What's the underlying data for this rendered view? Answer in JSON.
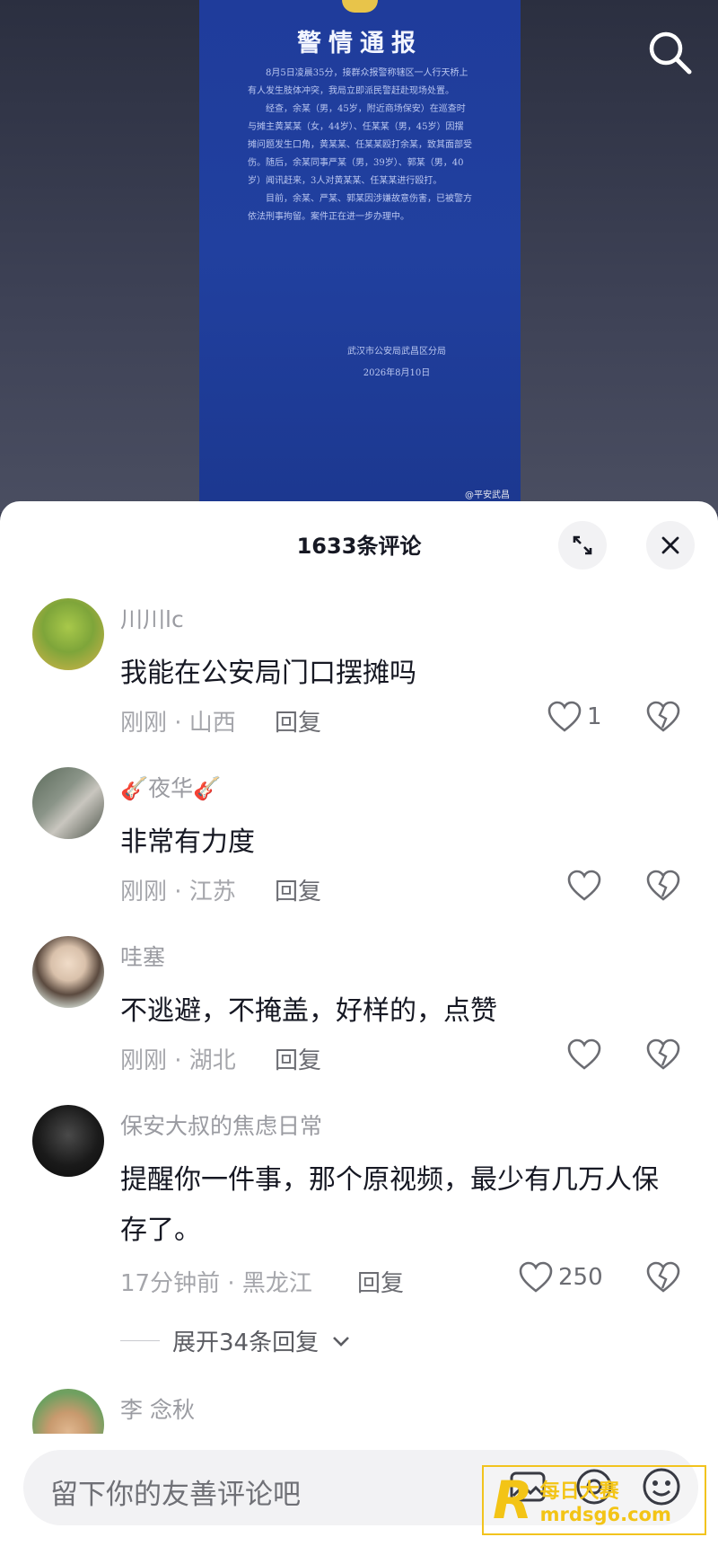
{
  "video": {
    "notice_title": "警情通报",
    "notice_paragraphs": [
      "8月5日凌晨35分，接群众报警称辖区一人行天桥上有人发生肢体冲突，我局立即派民警赶赴现场处置。",
      "经查，余某（男，45岁，附近商场保安）在巡查时与摊主黄某某（女，44岁）、任某某（男，45岁）因摆摊问题发生口角，黄某某、任某某殴打余某，致其面部受伤。随后，余某同事严某（男，39岁）、郭某（男，40岁）闻讯赶来，3人对黄某某、任某某进行殴打。",
      "目前，余某、严某、郭某因涉嫌故意伤害，已被警方依法刑事拘留。案件正在进一步办理中。"
    ],
    "notice_org": "武汉市公安局武昌区分局",
    "notice_date": "2026年8月10日",
    "source_label": "@平安武昌"
  },
  "header": {
    "comment_count_title": "1633条评论"
  },
  "comments": [
    {
      "username": "川川lc",
      "text": "我能在公安局门口摆摊吗",
      "time_location": "刚刚 · 山西",
      "reply_label": "回复",
      "like_count": "1"
    },
    {
      "username": "🎸夜华🎸",
      "text": "非常有力度",
      "time_location": "刚刚 · 江苏",
      "reply_label": "回复",
      "like_count": ""
    },
    {
      "username": "哇塞",
      "text": "不逃避，不掩盖，好样的，点赞",
      "time_location": "刚刚 · 湖北",
      "reply_label": "回复",
      "like_count": ""
    },
    {
      "username": "保安大叔的焦虑日常",
      "text": "提醒你一件事，那个原视频，最少有几万人保存了。",
      "time_location": "17分钟前 · 黑龙江",
      "reply_label": "回复",
      "like_count": "250",
      "expand_replies_label": "展开34条回复"
    },
    {
      "username": "李 念秋"
    }
  ],
  "input": {
    "placeholder": "留下你的友善评论吧"
  },
  "watermark": {
    "logo_letter": "R",
    "name": "每日大赛",
    "url": "mrdsg6.com"
  },
  "colors": {
    "text_primary": "#161823",
    "text_secondary": "#9a9ba1",
    "notice_blue": "#21409f",
    "watermark_yellow": "#f3c416"
  }
}
